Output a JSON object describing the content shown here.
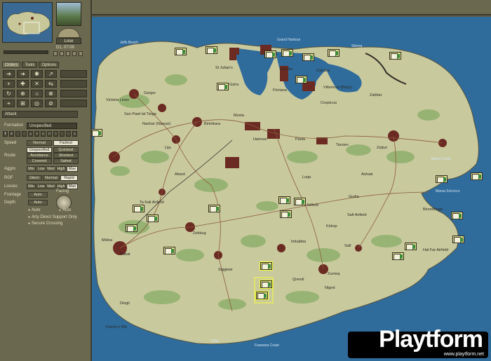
{
  "clock": {
    "date_label": "Lose",
    "time": "D1, 07:00"
  },
  "tabs": [
    "Orders",
    "Tools",
    "Options"
  ],
  "order_section": "Attack",
  "formation": {
    "label": "Formation",
    "value": "Unspecified"
  },
  "speed": {
    "label": "Speed",
    "options": [
      "Normal",
      "Fastest"
    ]
  },
  "route": {
    "label": "Route",
    "options": [
      "Unspecified",
      "Quickest",
      "Avoidance",
      "Shortest",
      "Covered",
      "Safest"
    ]
  },
  "aggro": {
    "label": "Aggro",
    "options": [
      "Min",
      "Low",
      "Med",
      "High",
      "Max"
    ]
  },
  "rof": {
    "label": "ROF",
    "options": [
      "Silent",
      "Normal",
      "Rapid"
    ]
  },
  "losses": {
    "label": "Losses",
    "options": [
      "Min",
      "Low",
      "Med",
      "High",
      "Max"
    ]
  },
  "frontage": {
    "label": "Frontage",
    "value": "Auto"
  },
  "depth": {
    "label": "Depth",
    "value": "Auto"
  },
  "facing": {
    "label": "Facing",
    "value": "Auto"
  },
  "checks": [
    "Arty Direct Support Only",
    "Secure Crossing"
  ],
  "places": {
    "jeffs_beach": "Jeffs Beach",
    "grand_harbour": "Grand Harbour",
    "sliema": "Sliema",
    "valletta": "Valletta",
    "st_julians": "St Julian's",
    "gzira": "Gzira",
    "floriana": "Floriana",
    "calcara": "Calcara",
    "vittoriosa": "Vittoriosa (Birgu)",
    "cospicua": "Cospicua",
    "zabbar": "Zabbar",
    "gargur": "Gargur",
    "victoria_lines": "Victoria Lines",
    "san_pawl": "San Pawl tal Targa",
    "naxxar": "Nashar (Naxxar)",
    "birkirkara": "Birkirkara",
    "mosta": "Mosta",
    "hamrun": "Hamrun",
    "paola": "Paola",
    "tarxien": "Tarxien",
    "zejtun": "Zejtun",
    "lija": "Lija",
    "attard": "Attard",
    "ashiak": "Ashiak",
    "luqa": "Luqa",
    "airfield": "Airfield",
    "gudia": "Gudia",
    "safi_airfield": "Safi Airfield",
    "ta_kali": "Ta Kali Airfield",
    "zebbug": "Zebbug",
    "mdina": "Mdina",
    "rabat": "Rabat",
    "kirkop": "Kirkop",
    "imkabba": "Imkabba",
    "safi": "Safi",
    "siggiewi": "Siggiewi",
    "qrendi": "Qrendi",
    "zurrieq": "Zurrieq",
    "nigret": "Nigret",
    "hal_far": "Hal Far Airfield",
    "birzebbuga": "Birzebbuga",
    "marsaxlokk": "Marsa Scirocco",
    "marsa_scala": "Marsa Scala",
    "dingli": "Dingli",
    "fomm": "Fomm ir Rih",
    "filfla": "Filfla",
    "fawwara": "Fawwara Coast"
  },
  "watermark": {
    "brand": "Playtform",
    "url": "www.playtform.net"
  }
}
